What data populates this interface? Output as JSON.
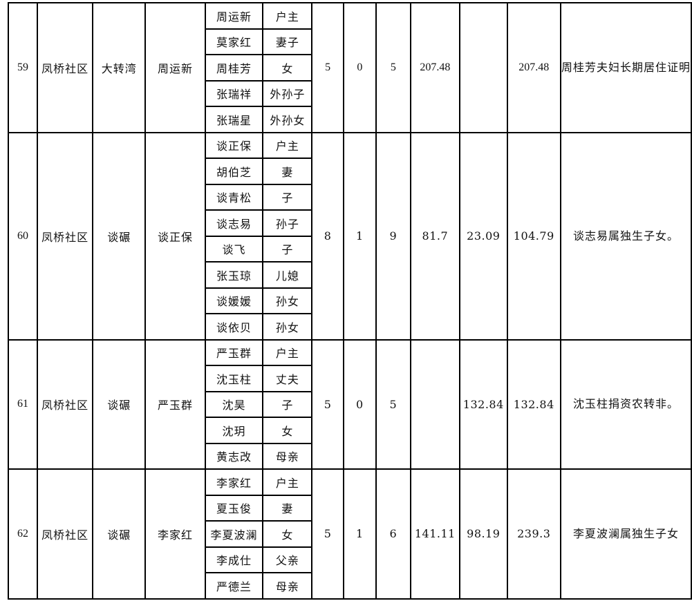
{
  "households": [
    {
      "no": "59",
      "community": "凤桥社区",
      "group": "大转湾",
      "head": "周运新",
      "members": [
        {
          "name": "周运新",
          "relation": "户主"
        },
        {
          "name": "莫家红",
          "relation": "妻子"
        },
        {
          "name": "周桂芳",
          "relation": "女"
        },
        {
          "name": "张瑞祥",
          "relation": "外孙子"
        },
        {
          "name": "张瑞星",
          "relation": "外孙女"
        }
      ],
      "count_a": "5",
      "count_b": "0",
      "count_total": "5",
      "amount_a": "207.48",
      "amount_b": "",
      "amount_total": "207.48",
      "note": "周桂芳夫妇长期居住证明",
      "num_style": "serif"
    },
    {
      "no": "60",
      "community": "凤桥社区",
      "group": "谈碾",
      "head": "谈正保",
      "members": [
        {
          "name": "谈正保",
          "relation": "户主"
        },
        {
          "name": "胡伯芝",
          "relation": "妻"
        },
        {
          "name": "谈青松",
          "relation": "子"
        },
        {
          "name": "谈志易",
          "relation": "孙子"
        },
        {
          "name": "谈飞",
          "relation": "子"
        },
        {
          "name": "张玉琼",
          "relation": "儿媳"
        },
        {
          "name": "谈媛媛",
          "relation": "孙女"
        },
        {
          "name": "谈依贝",
          "relation": "孙女"
        }
      ],
      "count_a": "8",
      "count_b": "1",
      "count_total": "9",
      "amount_a": "81.7",
      "amount_b": "23.09",
      "amount_total": "104.79",
      "note": "谈志易属独生子女。",
      "num_style": "wide"
    },
    {
      "no": "61",
      "community": "凤桥社区",
      "group": "谈碾",
      "head": "严玉群",
      "members": [
        {
          "name": "严玉群",
          "relation": "户主"
        },
        {
          "name": "沈玉柱",
          "relation": "丈夫"
        },
        {
          "name": "沈昊",
          "relation": "子"
        },
        {
          "name": "沈玥",
          "relation": "女"
        },
        {
          "name": "黄志改",
          "relation": "母亲"
        }
      ],
      "count_a": "5",
      "count_b": "0",
      "count_total": "5",
      "amount_a": "",
      "amount_b": "132.84",
      "amount_total": "132.84",
      "note": "沈玉柱捐资农转非。",
      "num_style": "wide"
    },
    {
      "no": "62",
      "community": "凤桥社区",
      "group": "谈碾",
      "head": "李家红",
      "members": [
        {
          "name": "李家红",
          "relation": "户主"
        },
        {
          "name": "夏玉俊",
          "relation": "妻"
        },
        {
          "name": "李夏波澜",
          "relation": "女"
        },
        {
          "name": "李成仕",
          "relation": "父亲"
        },
        {
          "name": "严德兰",
          "relation": "母亲"
        }
      ],
      "count_a": "5",
      "count_b": "1",
      "count_total": "6",
      "amount_a": "141.11",
      "amount_b": "98.19",
      "amount_total": "239.3",
      "note": "李夏波澜属独生子女",
      "num_style": "wide"
    }
  ]
}
